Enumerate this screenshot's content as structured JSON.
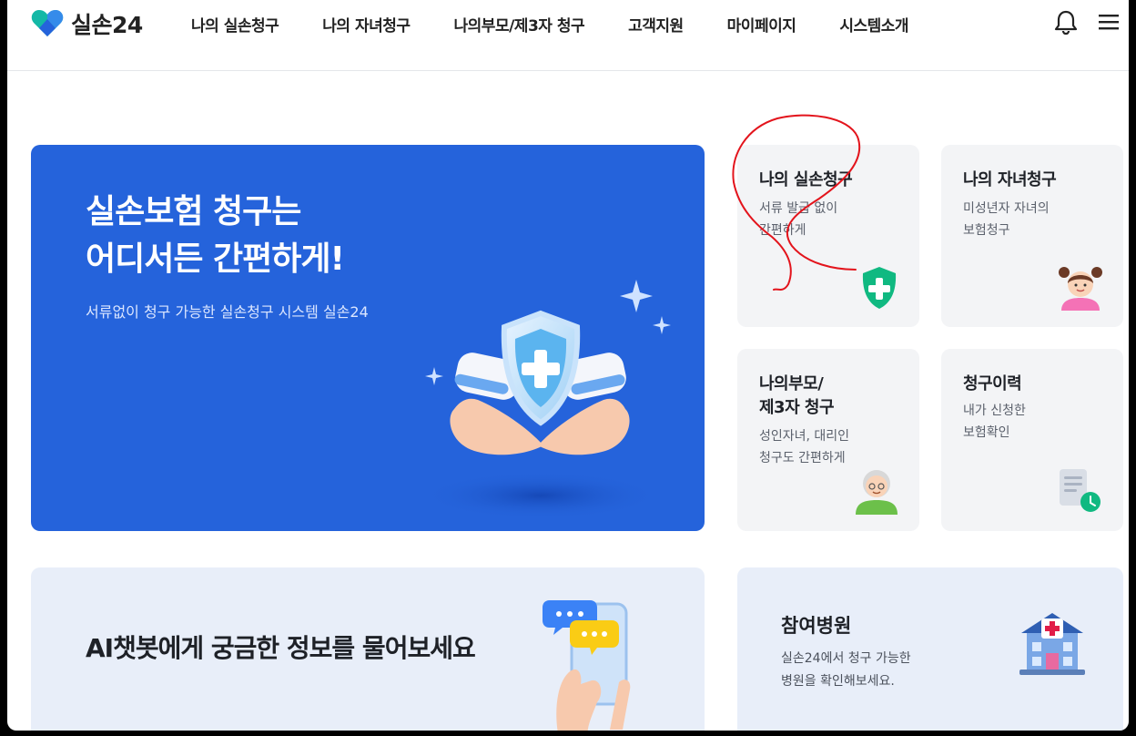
{
  "header": {
    "logo_text": "실손24",
    "nav": [
      {
        "label": "나의 실손청구"
      },
      {
        "label": "나의 자녀청구"
      },
      {
        "label": "나의부모/제3자 청구"
      },
      {
        "label": "고객지원"
      },
      {
        "label": "마이페이지"
      },
      {
        "label": "시스템소개"
      }
    ],
    "icons": [
      "bell-icon",
      "menu-icon"
    ]
  },
  "hero": {
    "title_line1": "실손보험 청구는",
    "title_line2": "어디서든 간편하게!",
    "subtitle": "서류없이 청구 가능한 실손청구 시스템 실손24",
    "illustration": "hands-holding-shield"
  },
  "cards": {
    "my_claim": {
      "title": "나의 실손청구",
      "desc1": "서류 발급 없이",
      "desc2": "간편하게",
      "icon": "shield-plus-icon"
    },
    "child_claim": {
      "title": "나의 자녀청구",
      "desc1": "미성년자 자녀의",
      "desc2": "보험청구",
      "icon": "girl-icon"
    },
    "parent_claim": {
      "title1": "나의부모/",
      "title2": "제3자 청구",
      "desc1": "성인자녀, 대리인",
      "desc2": "청구도 간편하게",
      "icon": "grandparent-icon"
    },
    "history": {
      "title": "청구이력",
      "desc1": "내가 신청한",
      "desc2": "보험확인",
      "icon": "document-clock-icon"
    }
  },
  "ai_banner": {
    "title": "AI챗봇에게 궁금한 정보를 물어보세요"
  },
  "hospital_banner": {
    "title": "참여병원",
    "desc1": "실손24에서 청구 가능한",
    "desc2": "병원을 확인해보세요."
  },
  "colors": {
    "brand_blue": "#2563db",
    "card_bg": "#f3f4f6",
    "accent_green": "#10b981",
    "annotation_red": "#e3141c"
  }
}
